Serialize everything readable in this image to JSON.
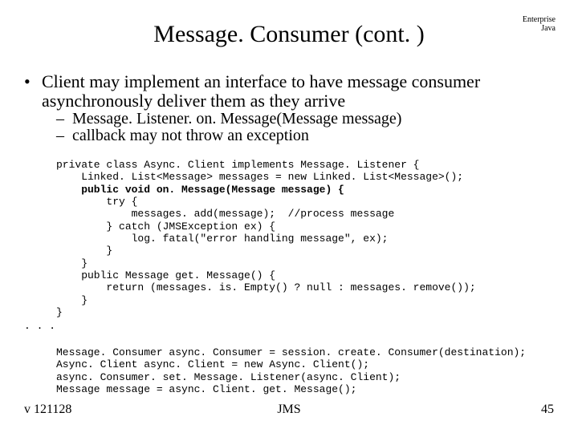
{
  "title": "Message. Consumer (cont. )",
  "corner": {
    "line1": "Enterprise",
    "line2": "Java"
  },
  "bullet": {
    "marker": "•",
    "text": "Client may implement an interface to have message consumer asynchronously deliver them as they arrive"
  },
  "subs": [
    {
      "marker": "–",
      "text": "Message. Listener. on. Message(Message message)"
    },
    {
      "marker": "–",
      "text": "callback may not throw an exception"
    }
  ],
  "code": [
    "private class Async. Client implements Message. Listener {",
    "    Linked. List<Message> messages = new Linked. List<Message>();",
    "    public void on. Message(Message message) {",
    "        try {",
    "            messages. add(message);  //process message",
    "        } catch (JMSException ex) {",
    "            log. fatal(\"error handling message\", ex);",
    "        }",
    "    }",
    "    public Message get. Message() {",
    "        return (messages. is. Empty() ? null : messages. remove());",
    "    }",
    "}"
  ],
  "ellipsis": ". . .",
  "code2": [
    "Message. Consumer async. Consumer = session. create. Consumer(destination);",
    "Async. Client async. Client = new Async. Client();",
    "async. Consumer. set. Message. Listener(async. Client);",
    "Message message = async. Client. get. Message();"
  ],
  "footer": {
    "left": "v 121128",
    "center": "JMS",
    "right": "45"
  }
}
